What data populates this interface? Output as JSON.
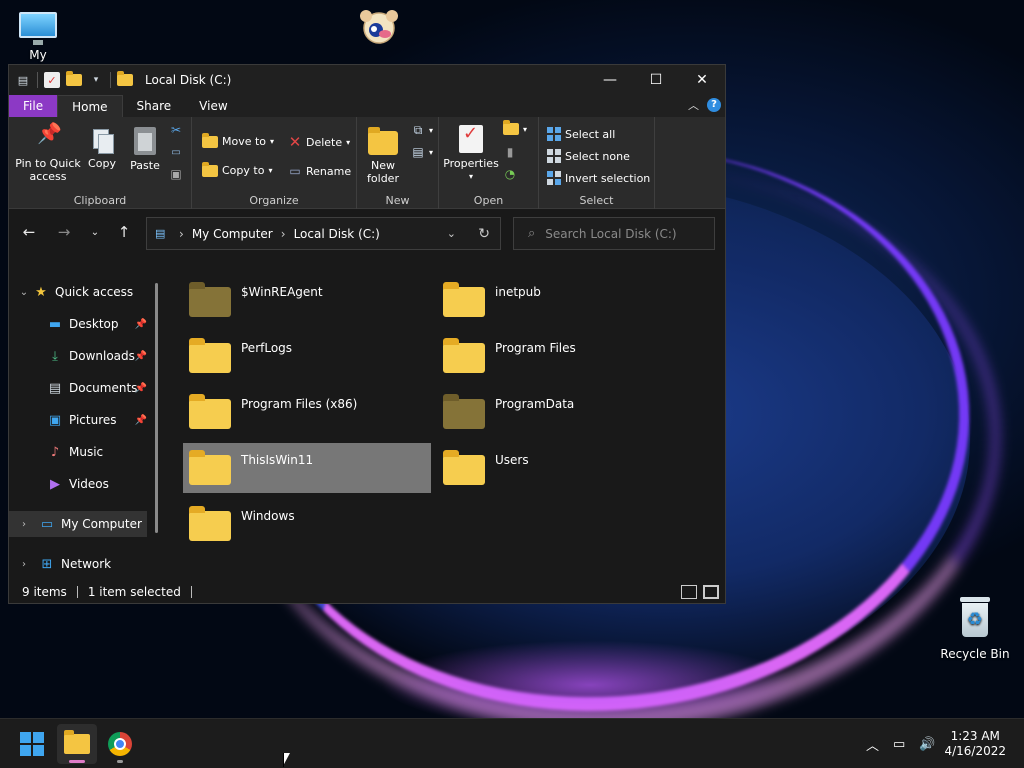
{
  "desktop": {
    "icons": [
      {
        "label": "My Computer",
        "icon": "monitor-icon"
      },
      {
        "label": "Recycle Bin",
        "icon": "recycle-bin-icon"
      }
    ]
  },
  "window": {
    "title": "Local Disk (C:)",
    "controls": {
      "minimize": "—",
      "maximize": "☐",
      "close": "✕"
    }
  },
  "ribbon_tabs": [
    "File",
    "Home",
    "Share",
    "View"
  ],
  "ribbon": {
    "clipboard": {
      "name": "Clipboard",
      "pin": "Pin to Quick access",
      "copy": "Copy",
      "paste": "Paste"
    },
    "organize": {
      "name": "Organize",
      "move_to": "Move to",
      "copy_to": "Copy to",
      "delete": "Delete",
      "rename": "Rename"
    },
    "new": {
      "name": "New",
      "new_folder": "New folder"
    },
    "open": {
      "name": "Open",
      "properties": "Properties"
    },
    "select": {
      "name": "Select",
      "select_all": "Select all",
      "select_none": "Select none",
      "invert": "Invert selection"
    }
  },
  "address": {
    "crumbs": [
      "My Computer",
      "Local Disk (C:)"
    ],
    "search_placeholder": "Search Local Disk (C:)"
  },
  "nav_pane": {
    "quick_access": "Quick access",
    "items": [
      {
        "label": "Desktop",
        "pinned": true
      },
      {
        "label": "Downloads",
        "pinned": true
      },
      {
        "label": "Documents",
        "pinned": true
      },
      {
        "label": "Pictures",
        "pinned": true
      },
      {
        "label": "Music",
        "pinned": false
      },
      {
        "label": "Videos",
        "pinned": false
      }
    ],
    "my_computer": "My Computer",
    "network": "Network"
  },
  "files": [
    {
      "name": "$WinREAgent",
      "hidden": true
    },
    {
      "name": "inetpub",
      "hidden": false
    },
    {
      "name": "PerfLogs",
      "hidden": false
    },
    {
      "name": "Program Files",
      "hidden": false
    },
    {
      "name": "Program Files (x86)",
      "hidden": false
    },
    {
      "name": "ProgramData",
      "hidden": true
    },
    {
      "name": "ThisIsWin11",
      "hidden": false,
      "selected": true
    },
    {
      "name": "Users",
      "hidden": false
    },
    {
      "name": "Windows",
      "hidden": false
    }
  ],
  "status": {
    "count": "9 items",
    "selected": "1 item selected"
  },
  "taskbar": {
    "time": "1:23 AM",
    "date": "4/16/2022"
  },
  "colors": {
    "file_tab": "#8c39c5",
    "folder": "#f6cd4f",
    "accent": "#2f8de0"
  }
}
